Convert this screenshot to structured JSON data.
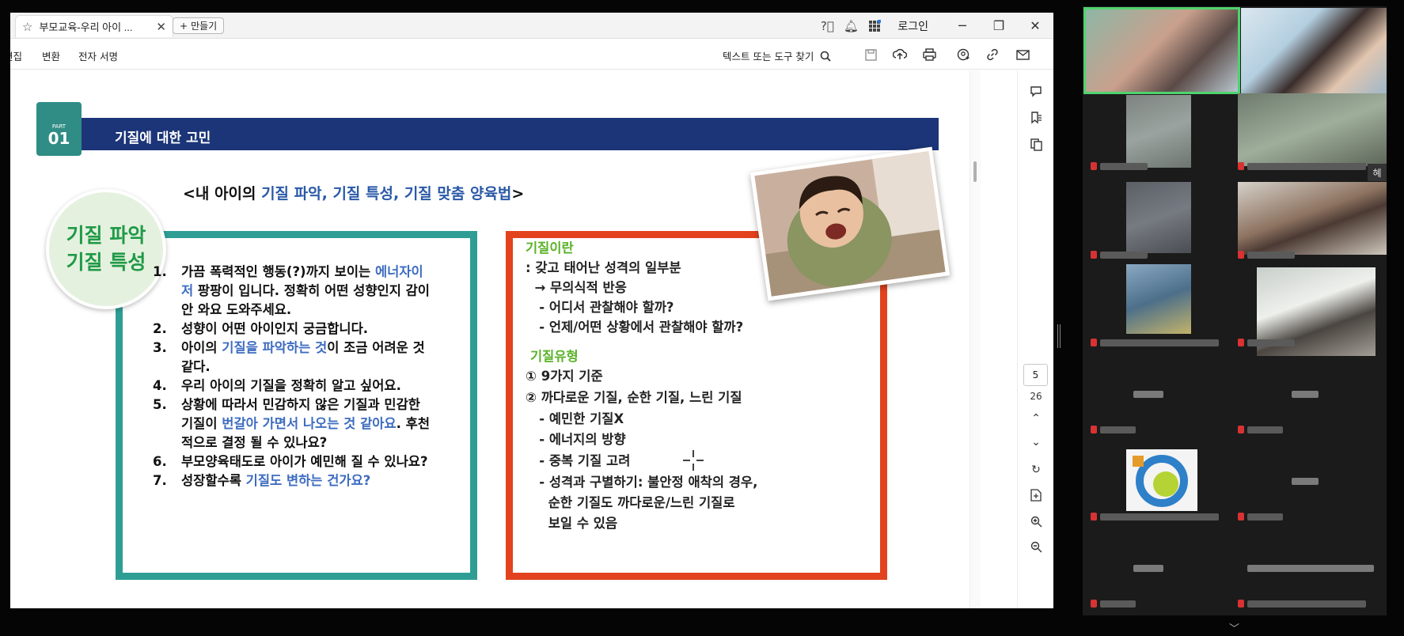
{
  "window": {
    "tab_title": "부모교육-우리 아이 ...",
    "new_button": "만들기",
    "login": "로그인"
  },
  "toolbar": {
    "menu_edit": "편집",
    "menu_convert": "변환",
    "menu_esign": "전자 서명",
    "find": "텍스트 또는 도구 찾기"
  },
  "pager": {
    "current": "5",
    "total": "26"
  },
  "slide": {
    "part_label": "PART",
    "part_number": "01",
    "banner": "기질에 대한 고민",
    "headline_pre": "<내 아이의 ",
    "headline_blue": "기질 파악, 기질 특성, 기질 맞춤 양육법",
    "headline_post": ">",
    "circle_line1": "기질 파악",
    "circle_line2": "기질 특성",
    "questions": [
      {
        "n": "1.",
        "a": "가끔 폭력적인 행동(?)까지 보이는 ",
        "b": "에너자이",
        "c": ""
      },
      {
        "n": "",
        "a": "",
        "b": "저",
        "c": " 팡팡이 입니다. 정확히 어떤 성향인지 감이"
      },
      {
        "n": "",
        "a": "안 와요 도와주세요.",
        "b": "",
        "c": ""
      },
      {
        "n": "2.",
        "a": "성향이 어떤 아이인지 궁금합니다.",
        "b": "",
        "c": ""
      },
      {
        "n": "3.",
        "a": "아이의 ",
        "b": "기질을 파악하는 것",
        "c": "이 조금 어려운 것"
      },
      {
        "n": "",
        "a": "같다.",
        "b": "",
        "c": ""
      },
      {
        "n": "4.",
        "a": "우리 아이의 기질을 정확히 알고 싶어요.",
        "b": "",
        "c": ""
      },
      {
        "n": "5.",
        "a": "상황에 따라서 민감하지 않은 기질과 민감한",
        "b": "",
        "c": ""
      },
      {
        "n": "",
        "a": "기질이 ",
        "b": "번갈아 가면서 나오는 것 같아요",
        "c": ". 후천"
      },
      {
        "n": "",
        "a": "적으로 결정 될 수 있나요?",
        "b": "",
        "c": ""
      },
      {
        "n": "6.",
        "a": "부모양육태도로 아이가 예민해 질 수 있나요?",
        "b": "",
        "c": ""
      },
      {
        "n": "7.",
        "a": "성장할수록 ",
        "b": "기질도 변하는 건가요?",
        "c": ""
      }
    ],
    "temperament_title": "기질이란",
    "temperament_lines": [
      ": 갖고 태어난 성격의 일부분",
      "  → 무의식적 반응",
      "   - 어디서 관찰해야 할까?",
      "   - 언제/어떤 상황에서 관찰해야 할까?"
    ],
    "types_title": "기질유형",
    "types_lines": [
      "① 9가지 기준",
      "② 까다로운 기질, 순한 기질, 느린 기질",
      "   - 예민한 기질X",
      "   - 에너지의 방향",
      "   - 중복 기질 고려",
      "   - 성격과 구별하기: 불안정 애착의 경우,",
      "     순한 기질도 까다로운/느린 기질로",
      "     보일 수 있음"
    ]
  },
  "gallery": {
    "side_chip": "혜"
  }
}
